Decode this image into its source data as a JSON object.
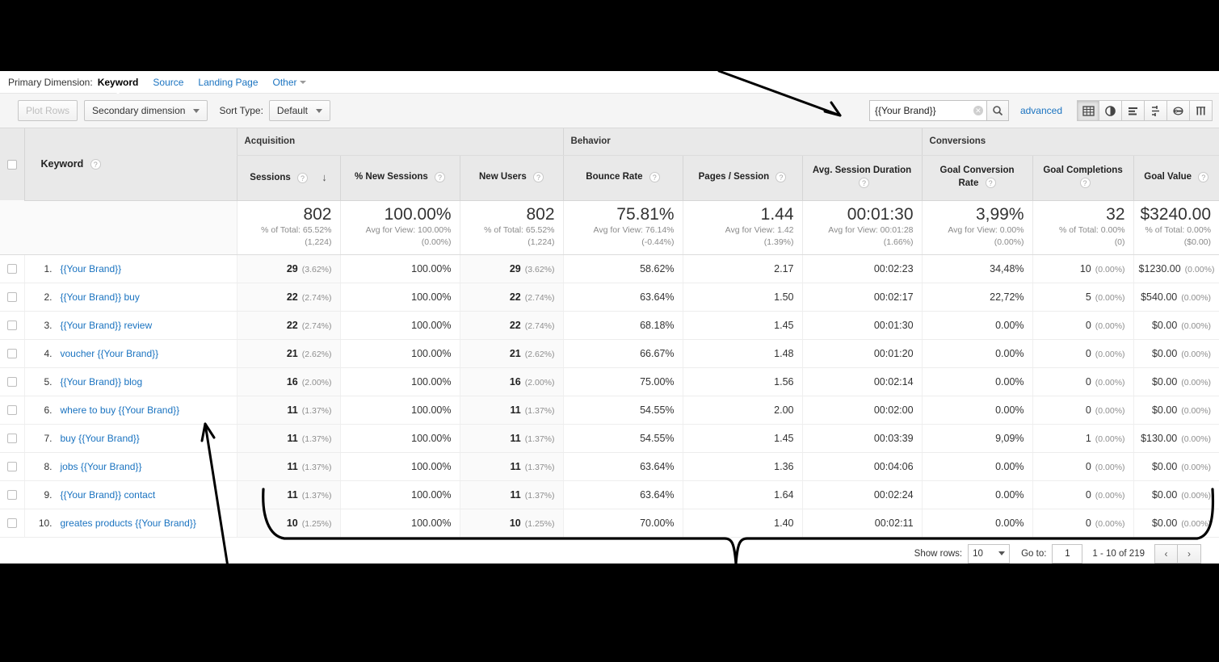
{
  "primary_dimension": {
    "label": "Primary Dimension:",
    "items": [
      {
        "text": "Keyword",
        "active": true
      },
      {
        "text": "Source",
        "active": false
      },
      {
        "text": "Landing Page",
        "active": false
      },
      {
        "text": "Other",
        "active": false,
        "caret": true
      }
    ]
  },
  "toolbar": {
    "plot_rows_label": "Plot Rows",
    "secondary_dimension_label": "Secondary dimension",
    "sort_type_label": "Sort Type:",
    "sort_type_value": "Default",
    "search_value": "{{Your Brand}}",
    "search_placeholder": "",
    "advanced_label": "advanced",
    "view_icons": [
      {
        "name": "table-view-icon",
        "glyph": "▦",
        "active": true
      },
      {
        "name": "pie-chart-view-icon",
        "glyph": "◕",
        "active": false
      },
      {
        "name": "bar-chart-view-icon",
        "glyph": "☰",
        "active": false
      },
      {
        "name": "comparison-view-icon",
        "glyph": "⇲",
        "active": false
      },
      {
        "name": "pivot-view-icon",
        "glyph": "⊖",
        "active": false
      },
      {
        "name": "performance-view-icon",
        "glyph": "Ⅽ",
        "active": false
      }
    ]
  },
  "table": {
    "groups": [
      {
        "label": "Acquisition",
        "span": 3
      },
      {
        "label": "Behavior",
        "span": 3
      },
      {
        "label": "Conversions",
        "span": 3
      }
    ],
    "dimension_header": "Keyword",
    "columns": [
      {
        "label": "Sessions",
        "sorted": true,
        "sort_dir": "↓"
      },
      {
        "label": "% New Sessions",
        "sorted": false
      },
      {
        "label": "New Users",
        "sorted": false
      },
      {
        "label": "Bounce Rate",
        "sorted": false
      },
      {
        "label": "Pages / Session",
        "sorted": false
      },
      {
        "label": "Avg. Session Duration",
        "sorted": false
      },
      {
        "label": "Goal Conversion Rate",
        "sorted": false
      },
      {
        "label": "Goal Completions",
        "sorted": false
      },
      {
        "label": "Goal Value",
        "sorted": false
      }
    ],
    "summary": [
      {
        "value": "802",
        "sub1": "% of Total: 65.52%",
        "sub2": "(1,224)"
      },
      {
        "value": "100.00%",
        "sub1": "Avg for View: 100.00%",
        "sub2": "(0.00%)"
      },
      {
        "value": "802",
        "sub1": "% of Total: 65.52%",
        "sub2": "(1,224)"
      },
      {
        "value": "75.81%",
        "sub1": "Avg for View: 76.14%",
        "sub2": "(-0.44%)"
      },
      {
        "value": "1.44",
        "sub1": "Avg for View: 1.42",
        "sub2": "(1.39%)"
      },
      {
        "value": "00:01:30",
        "sub1": "Avg for View: 00:01:28",
        "sub2": "(1.66%)"
      },
      {
        "value": "3,99%",
        "sub1": "Avg for View: 0.00%",
        "sub2": "(0.00%)"
      },
      {
        "value": "32",
        "sub1": "% of Total: 0.00%",
        "sub2": "(0)"
      },
      {
        "value": "$3240.00",
        "sub1": "% of Total: 0.00%",
        "sub2": "($0.00)"
      }
    ],
    "rows": [
      {
        "index": "1.",
        "keyword": "{{Your Brand}}",
        "sessions": "29",
        "sessions_pct": "(3.62%)",
        "new_sessions_pct": "100.00%",
        "new_users": "29",
        "new_users_pct": "(3.62%)",
        "bounce_rate": "58.62%",
        "pages_session": "2.17",
        "avg_duration": "00:02:23",
        "goal_conv_rate": "34,48%",
        "goal_completions": "10",
        "goal_completions_pct": "(0.00%)",
        "goal_value": "$1230.00",
        "goal_value_pct": "(0.00%)"
      },
      {
        "index": "2.",
        "keyword": "{{Your Brand}} buy",
        "sessions": "22",
        "sessions_pct": "(2.74%)",
        "new_sessions_pct": "100.00%",
        "new_users": "22",
        "new_users_pct": "(2.74%)",
        "bounce_rate": "63.64%",
        "pages_session": "1.50",
        "avg_duration": "00:02:17",
        "goal_conv_rate": "22,72%",
        "goal_completions": "5",
        "goal_completions_pct": "(0.00%)",
        "goal_value": "$540.00",
        "goal_value_pct": "(0.00%)"
      },
      {
        "index": "3.",
        "keyword": "{{Your Brand}} review",
        "sessions": "22",
        "sessions_pct": "(2.74%)",
        "new_sessions_pct": "100.00%",
        "new_users": "22",
        "new_users_pct": "(2.74%)",
        "bounce_rate": "68.18%",
        "pages_session": "1.45",
        "avg_duration": "00:01:30",
        "goal_conv_rate": "0.00%",
        "goal_completions": "0",
        "goal_completions_pct": "(0.00%)",
        "goal_value": "$0.00",
        "goal_value_pct": "(0.00%)"
      },
      {
        "index": "4.",
        "keyword": "voucher {{Your Brand}}",
        "sessions": "21",
        "sessions_pct": "(2.62%)",
        "new_sessions_pct": "100.00%",
        "new_users": "21",
        "new_users_pct": "(2.62%)",
        "bounce_rate": "66.67%",
        "pages_session": "1.48",
        "avg_duration": "00:01:20",
        "goal_conv_rate": "0.00%",
        "goal_completions": "0",
        "goal_completions_pct": "(0.00%)",
        "goal_value": "$0.00",
        "goal_value_pct": "(0.00%)"
      },
      {
        "index": "5.",
        "keyword": "{{Your Brand}} blog",
        "sessions": "16",
        "sessions_pct": "(2.00%)",
        "new_sessions_pct": "100.00%",
        "new_users": "16",
        "new_users_pct": "(2.00%)",
        "bounce_rate": "75.00%",
        "pages_session": "1.56",
        "avg_duration": "00:02:14",
        "goal_conv_rate": "0.00%",
        "goal_completions": "0",
        "goal_completions_pct": "(0.00%)",
        "goal_value": "$0.00",
        "goal_value_pct": "(0.00%)"
      },
      {
        "index": "6.",
        "keyword": "where to buy {{Your Brand}}",
        "sessions": "11",
        "sessions_pct": "(1.37%)",
        "new_sessions_pct": "100.00%",
        "new_users": "11",
        "new_users_pct": "(1.37%)",
        "bounce_rate": "54.55%",
        "pages_session": "2.00",
        "avg_duration": "00:02:00",
        "goal_conv_rate": "0.00%",
        "goal_completions": "0",
        "goal_completions_pct": "(0.00%)",
        "goal_value": "$0.00",
        "goal_value_pct": "(0.00%)"
      },
      {
        "index": "7.",
        "keyword": "buy {{Your Brand}}",
        "sessions": "11",
        "sessions_pct": "(1.37%)",
        "new_sessions_pct": "100.00%",
        "new_users": "11",
        "new_users_pct": "(1.37%)",
        "bounce_rate": "54.55%",
        "pages_session": "1.45",
        "avg_duration": "00:03:39",
        "goal_conv_rate": "9,09%",
        "goal_completions": "1",
        "goal_completions_pct": "(0.00%)",
        "goal_value": "$130.00",
        "goal_value_pct": "(0.00%)"
      },
      {
        "index": "8.",
        "keyword": "jobs {{Your Brand}}",
        "sessions": "11",
        "sessions_pct": "(1.37%)",
        "new_sessions_pct": "100.00%",
        "new_users": "11",
        "new_users_pct": "(1.37%)",
        "bounce_rate": "63.64%",
        "pages_session": "1.36",
        "avg_duration": "00:04:06",
        "goal_conv_rate": "0.00%",
        "goal_completions": "0",
        "goal_completions_pct": "(0.00%)",
        "goal_value": "$0.00",
        "goal_value_pct": "(0.00%)"
      },
      {
        "index": "9.",
        "keyword": "{{Your Brand}} contact",
        "sessions": "11",
        "sessions_pct": "(1.37%)",
        "new_sessions_pct": "100.00%",
        "new_users": "11",
        "new_users_pct": "(1.37%)",
        "bounce_rate": "63.64%",
        "pages_session": "1.64",
        "avg_duration": "00:02:24",
        "goal_conv_rate": "0.00%",
        "goal_completions": "0",
        "goal_completions_pct": "(0.00%)",
        "goal_value": "$0.00",
        "goal_value_pct": "(0.00%)"
      },
      {
        "index": "10.",
        "keyword": "greates products {{Your Brand}}",
        "sessions": "10",
        "sessions_pct": "(1.25%)",
        "new_sessions_pct": "100.00%",
        "new_users": "10",
        "new_users_pct": "(1.25%)",
        "bounce_rate": "70.00%",
        "pages_session": "1.40",
        "avg_duration": "00:02:11",
        "goal_conv_rate": "0.00%",
        "goal_completions": "0",
        "goal_completions_pct": "(0.00%)",
        "goal_value": "$0.00",
        "goal_value_pct": "(0.00%)"
      }
    ]
  },
  "footer": {
    "show_rows_label": "Show rows:",
    "show_rows_value": "10",
    "go_to_label": "Go to:",
    "go_to_value": "1",
    "range_text": "1 - 10 of 219",
    "prev_glyph": "‹",
    "next_glyph": "›"
  },
  "colors": {
    "link": "#1a73c0",
    "header_bg": "#e9e9e9",
    "toolbar_bg": "#f5f5f5",
    "text": "#333333",
    "muted": "#8e8e8e",
    "annotation": "#000000"
  }
}
